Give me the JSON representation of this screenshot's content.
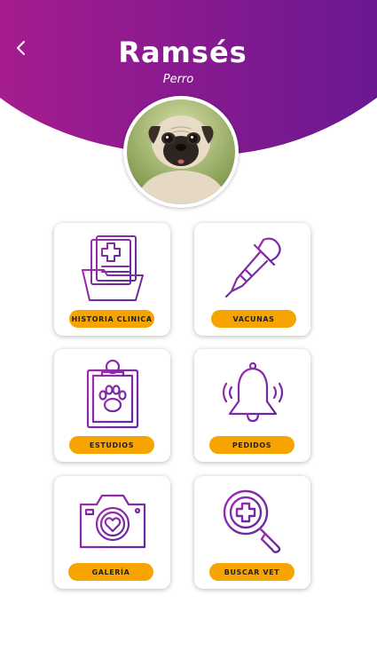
{
  "pet": {
    "name": "Ramsés",
    "species": "Perro"
  },
  "colors": {
    "header_start": "#a51c8f",
    "header_end": "#6a1891",
    "accent": "#f7a400",
    "icon_start": "#a02bb0",
    "icon_end": "#5f2a9c"
  },
  "menu": [
    {
      "label": "HISTORIA CLINICA",
      "icon": "medical-folder-icon"
    },
    {
      "label": "VACUNAS",
      "icon": "dropper-icon"
    },
    {
      "label": "ESTUDIOS",
      "icon": "paw-clipboard-icon"
    },
    {
      "label": "PEDIDOS",
      "icon": "bell-icon"
    },
    {
      "label": "GALERÍA",
      "icon": "camera-icon"
    },
    {
      "label": "BUSCAR VET",
      "icon": "search-plus-icon"
    }
  ]
}
